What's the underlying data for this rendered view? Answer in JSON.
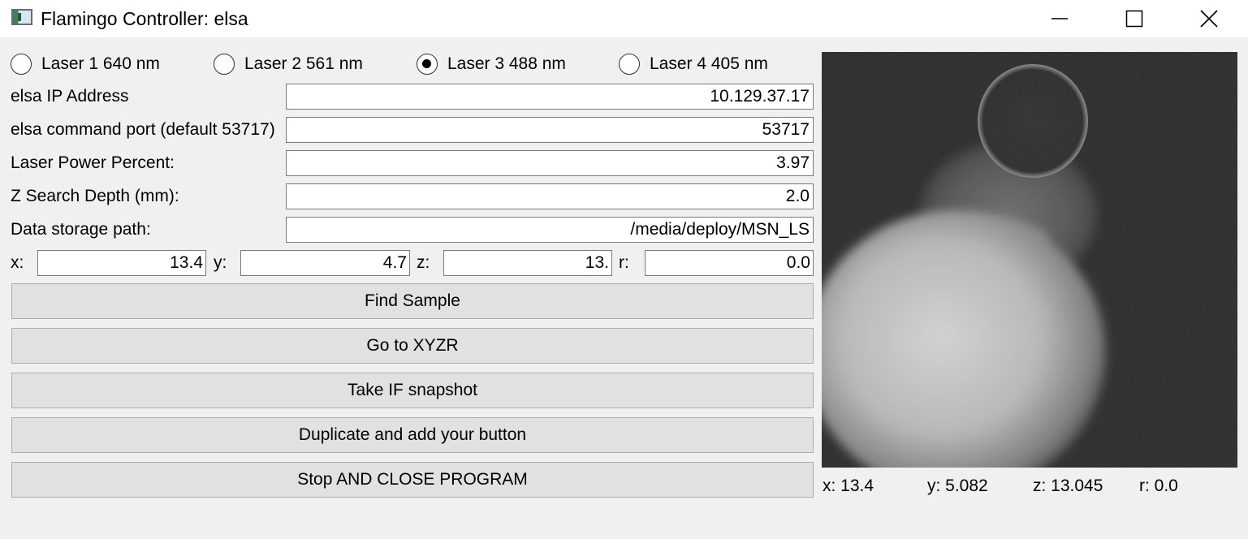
{
  "window": {
    "title": "Flamingo Controller: elsa",
    "controls": [
      "minimize-icon",
      "maximize-icon",
      "close-icon"
    ]
  },
  "lasers": [
    {
      "label": "Laser 1 640 nm",
      "selected": false
    },
    {
      "label": "Laser 2 561 nm",
      "selected": false
    },
    {
      "label": "Laser 3 488 nm",
      "selected": true
    },
    {
      "label": "Laser 4 405 nm",
      "selected": false
    }
  ],
  "fields": {
    "ip": {
      "label": "elsa IP Address",
      "value": "10.129.37.17"
    },
    "port": {
      "label": "elsa command port (default 53717)",
      "value": "53717"
    },
    "laser_power": {
      "label": "Laser Power Percent:",
      "value": "3.97"
    },
    "z_depth": {
      "label": "Z Search Depth (mm):",
      "value": "2.0"
    },
    "storage_path": {
      "label": "Data storage path:",
      "value": "/media/deploy/MSN_LS"
    }
  },
  "coords": {
    "x": {
      "label": "x:",
      "value": "13.4"
    },
    "y": {
      "label": "y:",
      "value": "4.7"
    },
    "z": {
      "label": "z:",
      "value": "13."
    },
    "r": {
      "label": "r:",
      "value": "0.0"
    }
  },
  "buttons": {
    "find_sample": "Find Sample",
    "go_to_xyzr": "Go to XYZR",
    "take_snapshot": "Take IF snapshot",
    "duplicate": "Duplicate and add your button",
    "stop_close": "Stop AND CLOSE PROGRAM"
  },
  "readout": {
    "x": "x: 13.4",
    "y": "y: 5.082",
    "z": "z: 13.045",
    "r": "r: 0.0"
  }
}
